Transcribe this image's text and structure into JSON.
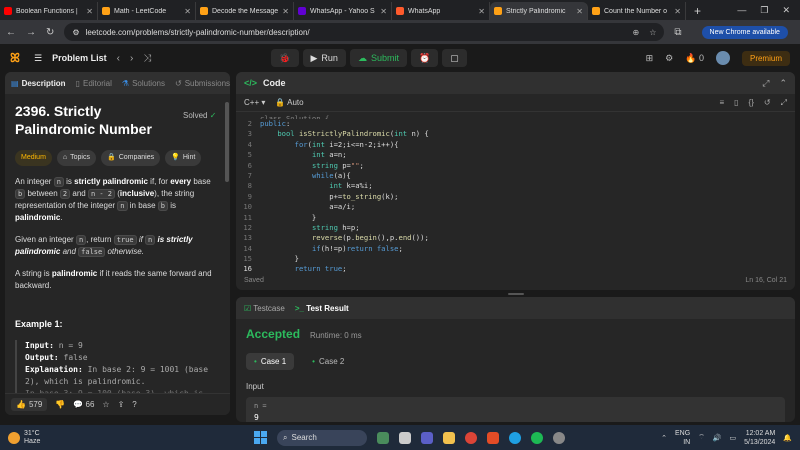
{
  "browser": {
    "tabs": [
      {
        "label": "Boolean Functions |",
        "color": "#ff0000"
      },
      {
        "label": "Math - LeetCode",
        "color": "#ffa116"
      },
      {
        "label": "Decode the Message",
        "color": "#ffa116"
      },
      {
        "label": "WhatsApp - Yahoo S",
        "color": "#6001d2"
      },
      {
        "label": "WhatsApp",
        "color": "#ff5a2c"
      },
      {
        "label": "Strictly Palindromic",
        "color": "#ffa116"
      },
      {
        "label": "Count the Number o",
        "color": "#ffa116"
      }
    ],
    "active_tab": 5,
    "url": "leetcode.com/problems/strictly-palindromic-number/description/",
    "chrome_badge": "New Chrome available"
  },
  "nav": {
    "problem_list": "Problem List",
    "run": "Run",
    "submit": "Submit",
    "streak": "0",
    "premium": "Premium"
  },
  "left": {
    "tabs": [
      "Description",
      "Editorial",
      "Solutions",
      "Submissions"
    ],
    "title": "2396. Strictly Palindromic Number",
    "solved": "Solved",
    "chips": [
      "Medium",
      "Topics",
      "Companies",
      "Hint"
    ],
    "p1": {
      "a": "An integer ",
      "n": "n",
      "b": " is ",
      "sp": "strictly palindromic",
      "c": " if, for ",
      "every": "every",
      "d": " base ",
      "bv": "b",
      "e": " between ",
      "two": "2",
      "f": " and ",
      "nm2": "n - 2",
      "g": " (",
      "incl": "inclusive",
      "h": "), the string representation of the integer ",
      "n2": "n",
      "i": " in base ",
      "b2": "b",
      "j": " is ",
      "pal": "palindromic",
      "k": "."
    },
    "p2": {
      "a": "Given an integer ",
      "n": "n",
      "b": ", return ",
      "t": "true",
      "c": " if ",
      "n2": "n",
      "d": " is strictly palindromic",
      "e": " and ",
      "f": "false",
      "g": " otherwise."
    },
    "p3": {
      "a": "A string is ",
      "pal": "palindromic",
      "b": " if it reads the same forward and backward."
    },
    "example_title": "Example 1:",
    "example": {
      "input_k": "Input:",
      "input_v": " n = 9",
      "output_k": "Output:",
      "output_v": " false",
      "expl_k": "Explanation:",
      "expl_v": " In base 2: 9 = 1001 (base 2), which is palindromic.",
      "next_v": "In base 3: 9 = 100 (base 3), which is"
    },
    "likes": "579",
    "comments": "66"
  },
  "code": {
    "header": "Code",
    "language": "C++",
    "mode": "Auto",
    "first_line": "class Solution {",
    "lines": [
      {
        "n": "2",
        "t": "public:"
      },
      {
        "n": "3",
        "t": "    bool isStrictlyPalindromic(int n) {"
      },
      {
        "n": "4",
        "t": "        for(int i=2;i<=n-2;i++){"
      },
      {
        "n": "5",
        "t": "            int a=n;"
      },
      {
        "n": "6",
        "t": "            string p=\"\";"
      },
      {
        "n": "7",
        "t": "            while(a){"
      },
      {
        "n": "8",
        "t": "                int k=a%i;"
      },
      {
        "n": "9",
        "t": "                p+=to_string(k);"
      },
      {
        "n": "10",
        "t": "                a=a/i;"
      },
      {
        "n": "11",
        "t": "            }"
      },
      {
        "n": "12",
        "t": "            string h=p;"
      },
      {
        "n": "13",
        "t": "            reverse(p.begin(),p.end());"
      },
      {
        "n": "14",
        "t": "            if(h!=p)return false;"
      },
      {
        "n": "15",
        "t": "        }"
      },
      {
        "n": "16",
        "t": "        return true;"
      }
    ],
    "saved": "Saved",
    "cursor": "Ln 16, Col 21"
  },
  "test": {
    "tabs": [
      "Testcase",
      "Test Result"
    ],
    "status": "Accepted",
    "runtime": "Runtime: 0 ms",
    "cases": [
      "Case 1",
      "Case 2"
    ],
    "input_label": "Input",
    "var": "n =",
    "value": "9"
  },
  "taskbar": {
    "temp": "31°C",
    "weather": "Haze",
    "search": "Search",
    "lang1": "ENG",
    "lang2": "IN",
    "time": "12:02 AM",
    "date": "5/13/2024"
  }
}
